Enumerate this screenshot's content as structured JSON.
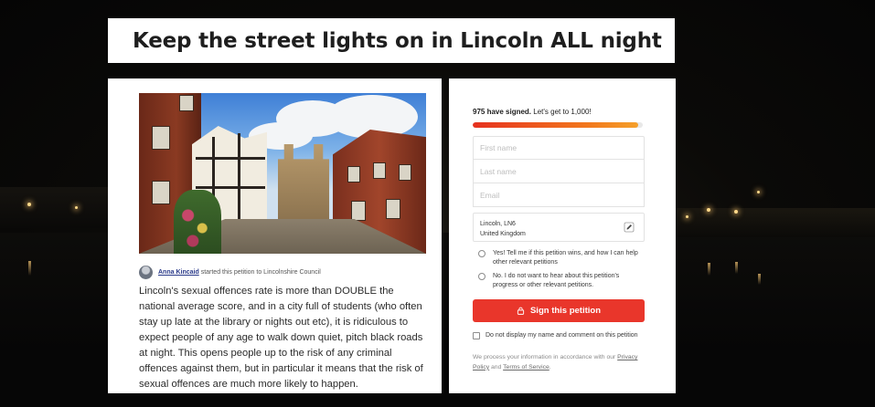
{
  "petition": {
    "title": "Keep the street lights on in Lincoln ALL night",
    "starter": {
      "name": "Anna Kincaid",
      "action_text": "started this petition to Lincolnshire Council"
    },
    "body": "Lincoln's sexual offences rate is more than DOUBLE the national average score, and in a city full of students (who often stay up late at the library or nights out etc), it is ridiculous to expect people of any age to walk down quiet, pitch black roads at night. This opens people up to the risk of any criminal offences against them, but in particular it means that the risk of sexual offences are much more likely to happen."
  },
  "sign_form": {
    "signed_count_text": "975 have signed.",
    "goal_text": "Let's get to 1,000!",
    "progress": 0.975,
    "first_name_placeholder": "First name",
    "last_name_placeholder": "Last name",
    "email_placeholder": "Email",
    "location_line1": "Lincoln, LN6",
    "location_line2": "United Kingdom",
    "option_yes": "Yes! Tell me if this petition wins, and how I can help other relevant petitions",
    "option_no": "No. I do not want to hear about this petition's progress or other relevant petitions.",
    "sign_button": "Sign this petition",
    "hide_name_label": "Do not display my name and comment on this petition",
    "privacy_prefix": "We process your information in accordance with our",
    "privacy_link": "Privacy Policy",
    "privacy_and": "and",
    "terms_link": "Terms of Service",
    "privacy_suffix": "."
  },
  "colors": {
    "accent": "#e9362b",
    "progress_start": "#e6311f",
    "progress_end": "#f5a02a"
  },
  "icons": {
    "edit": "pencil-icon",
    "lock": "lock-icon"
  }
}
